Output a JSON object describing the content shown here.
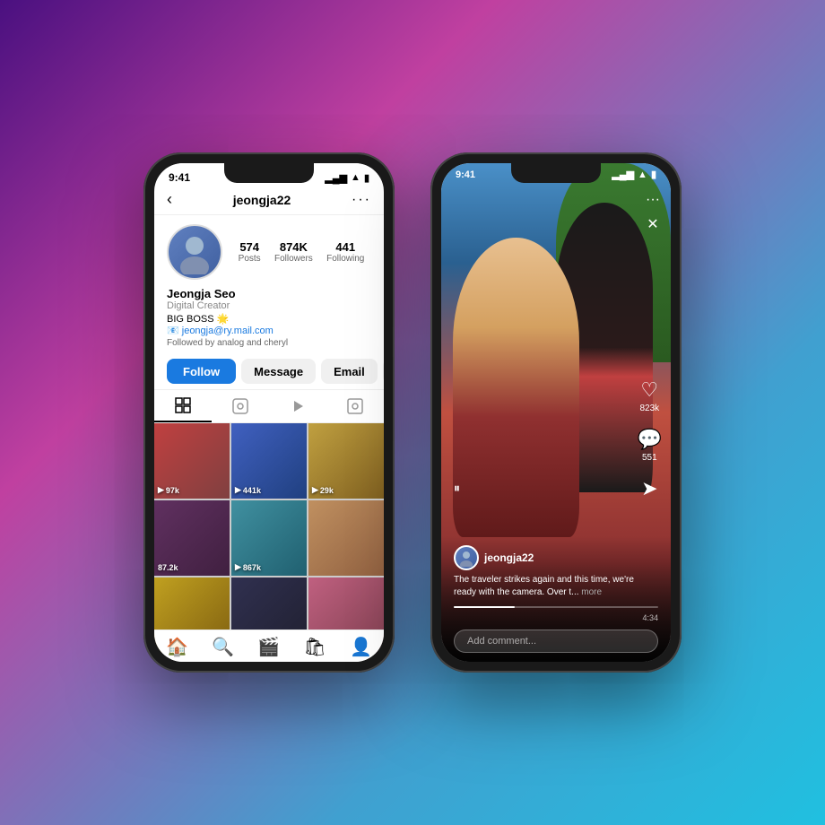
{
  "background": {
    "gradient_start": "#4a1080",
    "gradient_end": "#20c0e0"
  },
  "phone1": {
    "status_bar": {
      "time": "9:41",
      "icons": [
        "signal",
        "wifi",
        "battery"
      ]
    },
    "nav": {
      "back_icon": "‹",
      "username": "jeongja22",
      "dots_icon": "···"
    },
    "stats": {
      "posts_num": "574",
      "posts_label": "Posts",
      "followers_num": "874K",
      "followers_label": "Followers",
      "following_num": "441",
      "following_label": "Following"
    },
    "bio": {
      "name": "Jeongja Seo",
      "category": "Digital Creator",
      "text": "BIG BOSS 🌟",
      "email": "📧 jeongja@ry.mail.com",
      "followed_by": "Followed by analog and cheryl"
    },
    "buttons": {
      "follow": "Follow",
      "message": "Message",
      "email": "Email",
      "more": "⌄"
    },
    "grid": {
      "items": [
        {
          "views": "▶ 97k"
        },
        {
          "views": "▶ 441k"
        },
        {
          "views": "▶ 29k"
        },
        {
          "views": "87.2k"
        },
        {
          "views": "▶ 867k"
        },
        {
          "views": ""
        },
        {
          "views": ""
        },
        {
          "views": ""
        },
        {
          "views": ""
        }
      ]
    },
    "bottom_nav": {
      "icons": [
        "🏠",
        "🔍",
        "🎬",
        "🛍",
        "👤"
      ]
    }
  },
  "phone2": {
    "status_bar": {
      "time": "9:41",
      "icons": [
        "signal",
        "wifi",
        "battery"
      ]
    },
    "top_controls": {
      "dots": "···",
      "close": "✕"
    },
    "reel": {
      "right_actions": {
        "heart_icon": "♡",
        "heart_count": "823k",
        "comment_icon": "💬",
        "comment_count": "551",
        "share_icon": "➤"
      },
      "username": "jeongja22",
      "caption": "The traveler strikes again and this time, we're ready with the camera. Over t...",
      "more_label": "more",
      "progress_time": "4:34",
      "play_icon": "⏸",
      "comment_placeholder": "Add comment..."
    }
  }
}
